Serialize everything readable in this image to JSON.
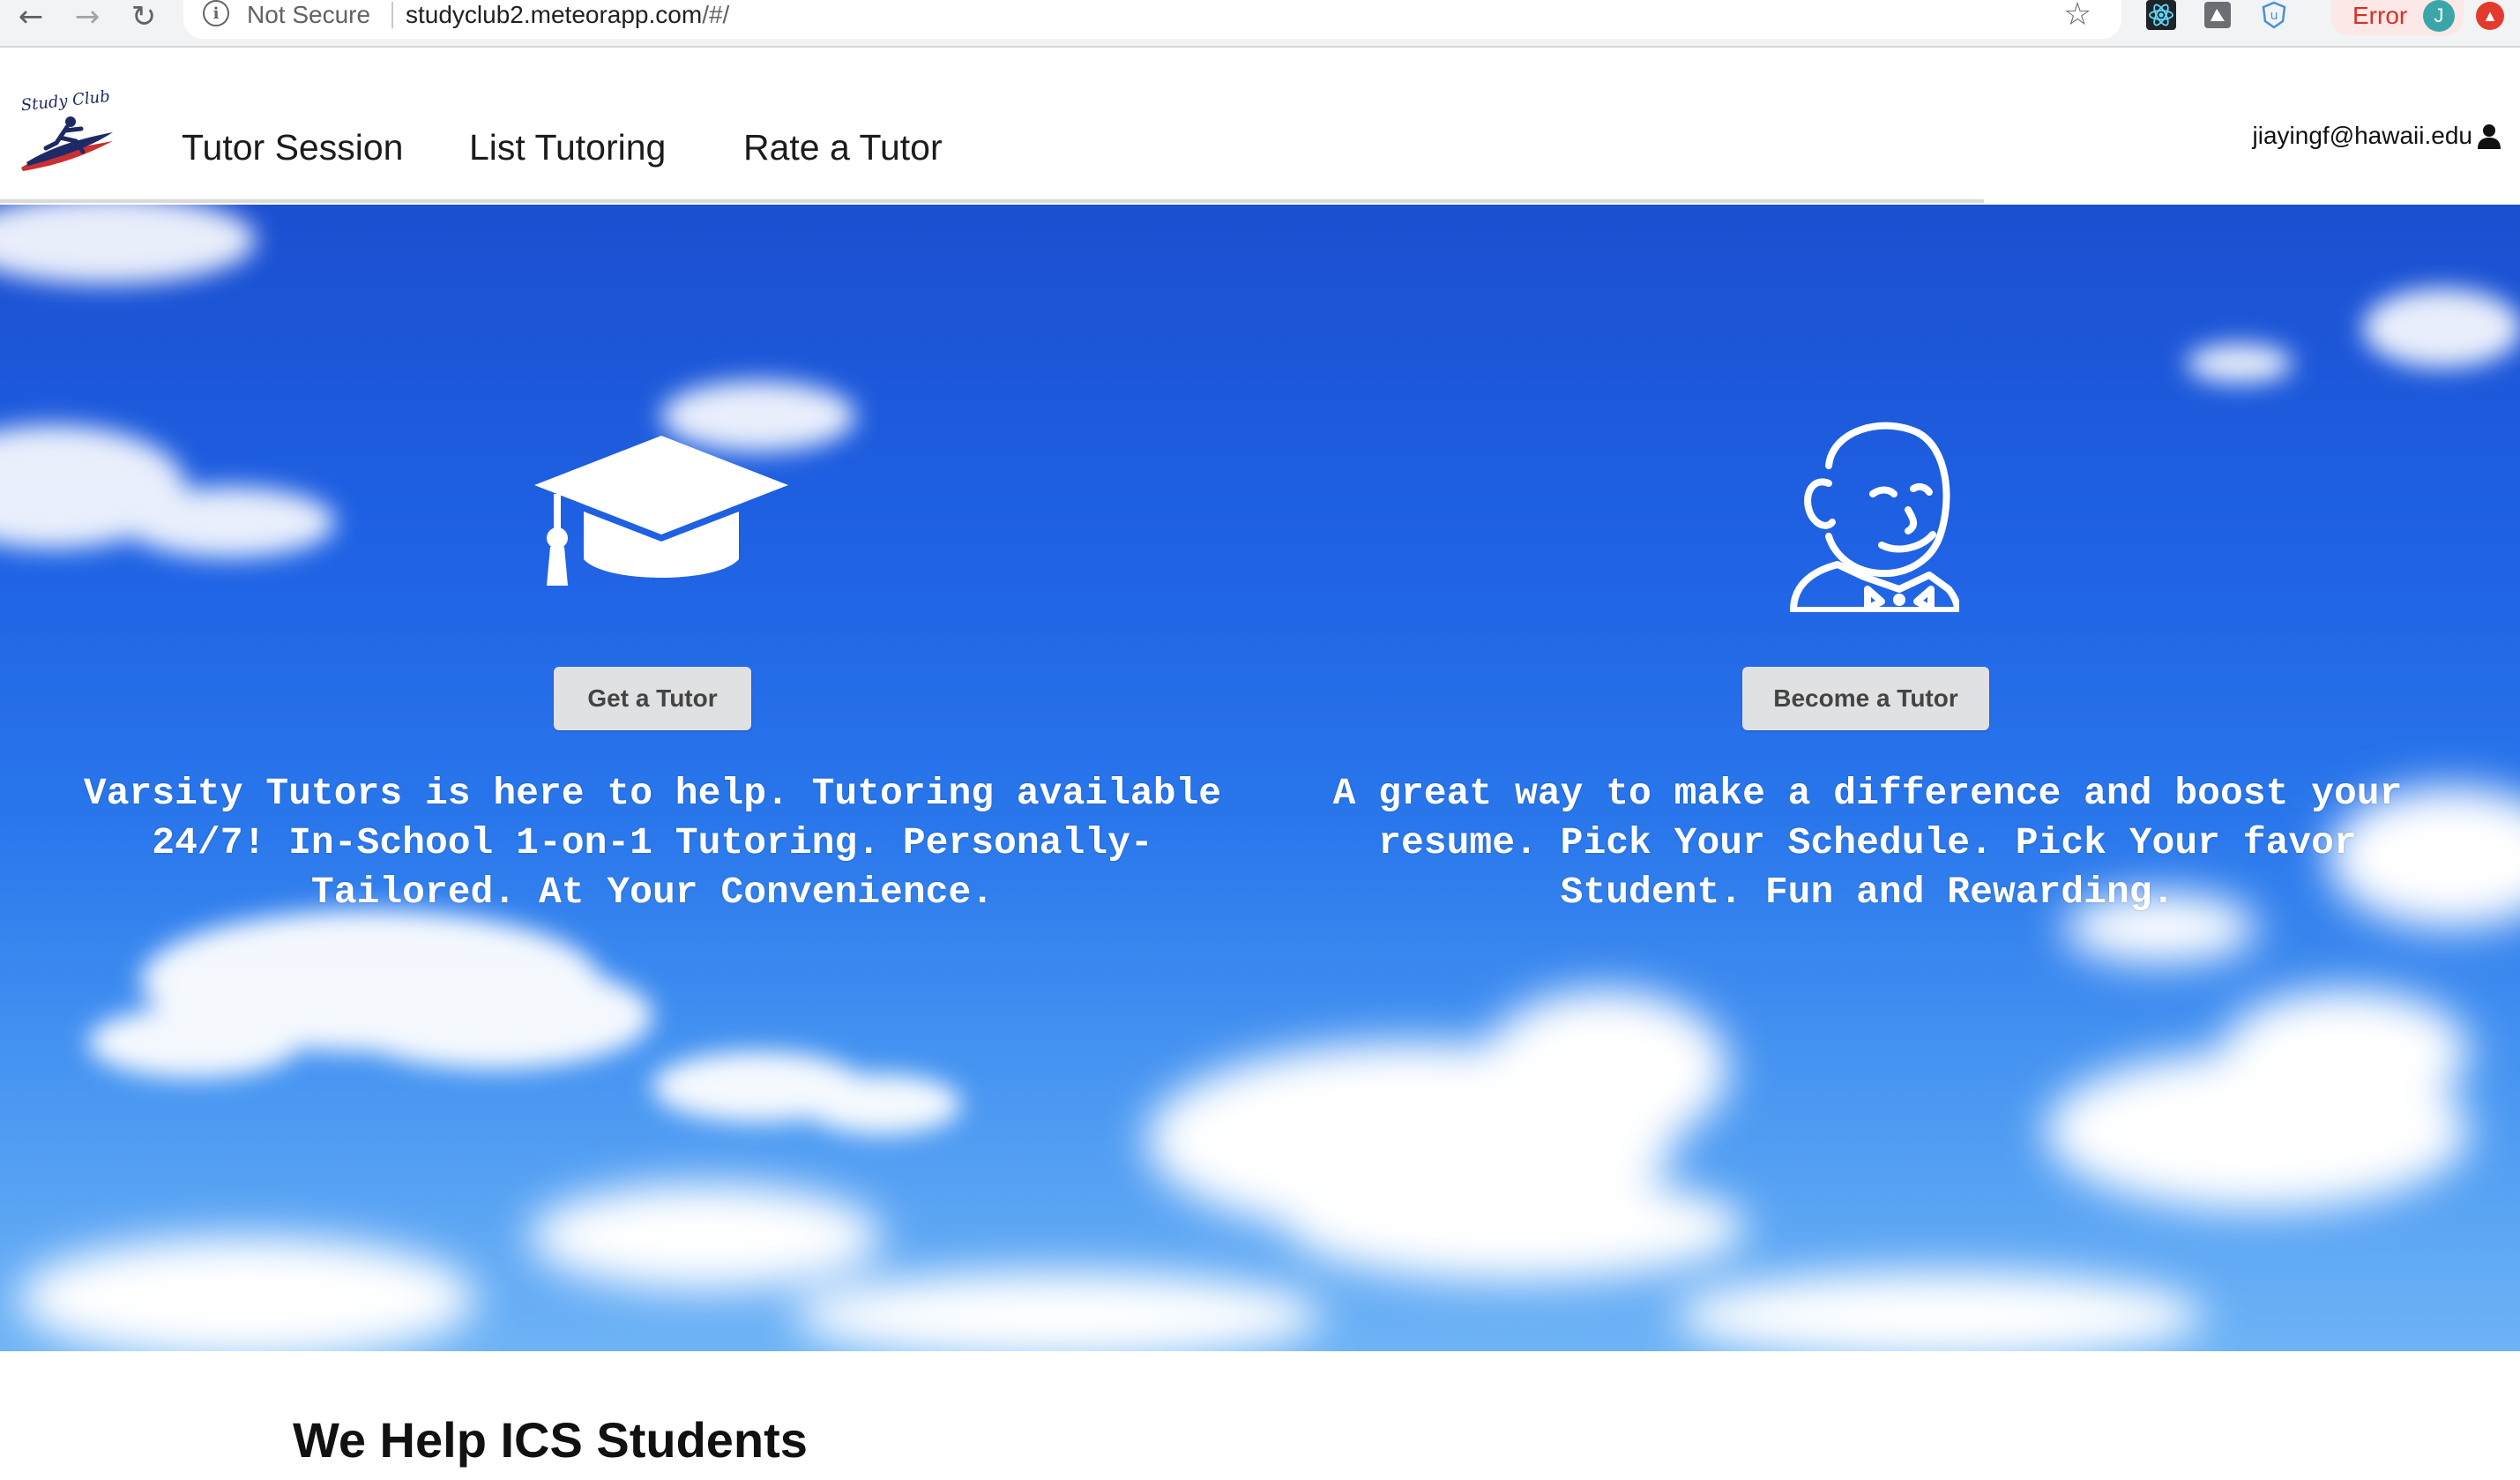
{
  "browser": {
    "security_label": "Not Secure",
    "url_host": "studyclub2.meteorapp.com",
    "url_path": "/#/",
    "error_label": "Error",
    "avatar_initial": "J"
  },
  "navbar": {
    "logo_text": "Study Club",
    "links": [
      {
        "label": "Tutor Session"
      },
      {
        "label": "List Tutoring"
      },
      {
        "label": "Rate a Tutor"
      }
    ],
    "user_email": "jiayingf@hawaii.edu"
  },
  "hero": {
    "left": {
      "icon": "graduation-cap-icon",
      "button_label": "Get a Tutor",
      "description": "Varsity Tutors is here to help. Tutoring available 24/7! In-School 1-on-1 Tutoring. Personally-Tailored. At Your Convenience."
    },
    "right": {
      "icon": "jenkins-butler-icon",
      "button_label": "Become a Tutor",
      "description": "A great way to make a difference and boost your resume. Pick Your Schedule. Pick Your favor Student. Fun and Rewarding."
    }
  },
  "section": {
    "title": "We Help ICS Students"
  },
  "colors": {
    "sky_top": "#1b4fd0",
    "sky_bottom": "#6eb3f6",
    "button_bg": "#e0e1e2",
    "error_red": "#d93025"
  }
}
